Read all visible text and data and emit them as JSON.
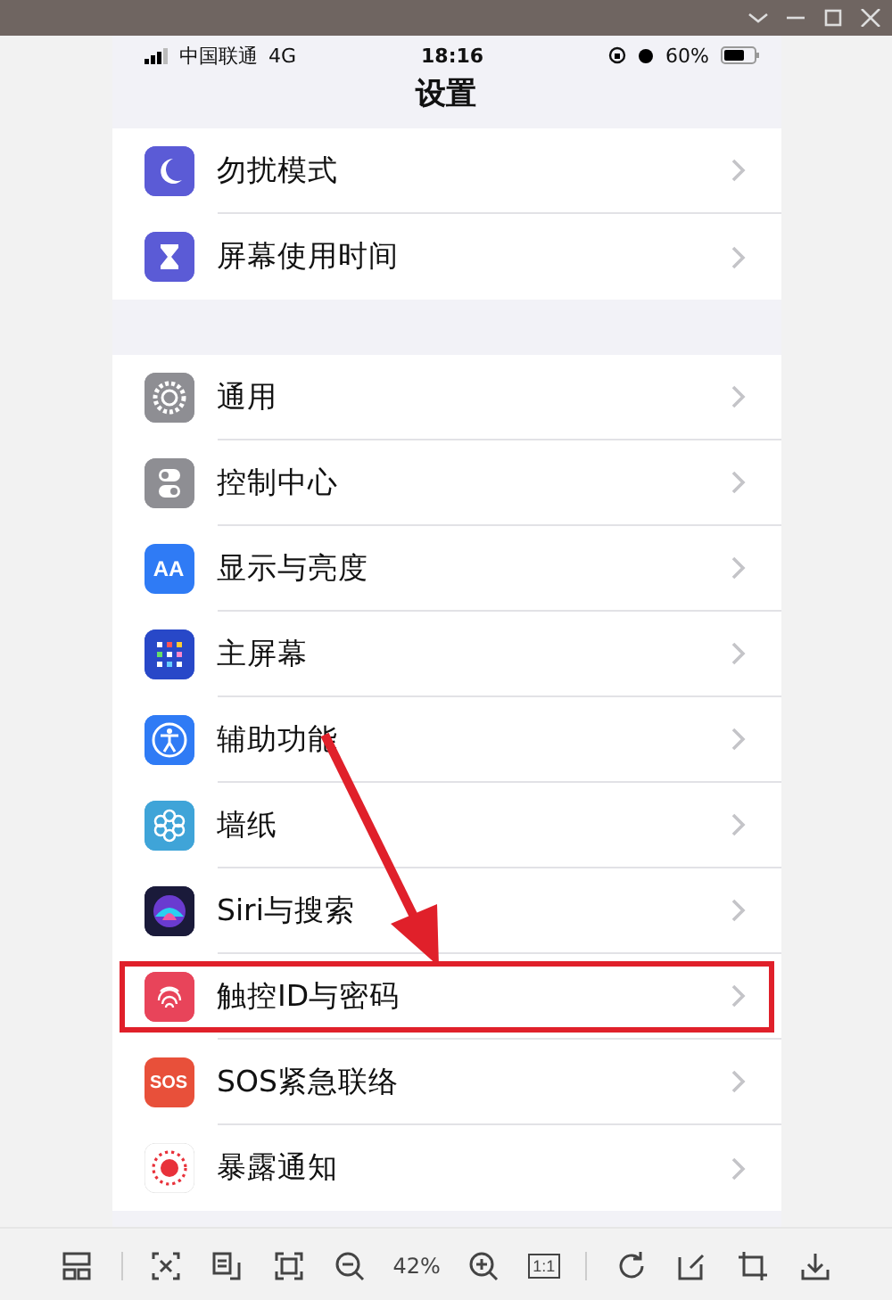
{
  "status_bar": {
    "carrier": "中国联通",
    "network": "4G",
    "time": "18:16",
    "battery": "60%"
  },
  "nav_title": "设置",
  "groups": [
    {
      "rows": [
        {
          "label": "勿扰模式",
          "highlighted": false
        },
        {
          "label": "屏幕使用时间",
          "highlighted": false
        }
      ]
    },
    {
      "rows": [
        {
          "label": "通用",
          "highlighted": false
        },
        {
          "label": "控制中心",
          "highlighted": false
        },
        {
          "label": "显示与亮度",
          "icon_text": "AA",
          "highlighted": false
        },
        {
          "label": "主屏幕",
          "highlighted": false
        },
        {
          "label": "辅助功能",
          "highlighted": false
        },
        {
          "label": "墙纸",
          "highlighted": false
        },
        {
          "label": "Siri与搜索",
          "highlighted": false
        },
        {
          "label": "触控ID与密码",
          "highlighted": true
        },
        {
          "label": "SOS紧急联络",
          "icon_text": "SOS",
          "highlighted": false
        },
        {
          "label": "暴露通知",
          "highlighted": false
        }
      ]
    }
  ],
  "toolbar": {
    "zoom": "42%",
    "actual_size": "1:1"
  }
}
